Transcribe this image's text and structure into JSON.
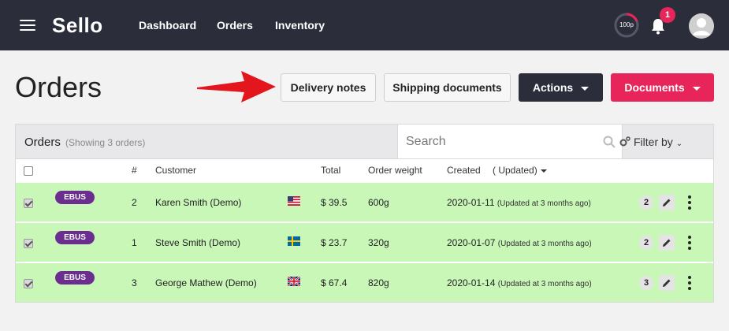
{
  "nav": {
    "logo": "Sello",
    "links": [
      "Dashboard",
      "Orders",
      "Inventory"
    ],
    "progress_label": "100p",
    "notification_count": "1"
  },
  "page": {
    "title": "Orders",
    "buttons": {
      "delivery_notes": "Delivery notes",
      "shipping_documents": "Shipping documents",
      "actions": "Actions",
      "documents": "Documents"
    }
  },
  "panel": {
    "title": "Orders",
    "subtitle": "(Showing 3 orders)",
    "search_placeholder": "Search",
    "filter_label": "Filter by"
  },
  "columns": {
    "number": "#",
    "customer": "Customer",
    "total": "Total",
    "weight": "Order weight",
    "created": "Created",
    "updated": "( Updated"
  },
  "rows": [
    {
      "tag": "EBUS",
      "number": "2",
      "customer": "Karen Smith (Demo)",
      "flag": "us-flag",
      "total": "$ 39.5",
      "weight": "600g",
      "created": "2020-01-11",
      "updated": "(Updated at 3 months ago)",
      "count": "2"
    },
    {
      "tag": "EBUS",
      "number": "1",
      "customer": "Steve Smith (Demo)",
      "flag": "se-flag",
      "total": "$ 23.7",
      "weight": "320g",
      "created": "2020-01-07",
      "updated": "(Updated at 3 months ago)",
      "count": "2"
    },
    {
      "tag": "EBUS",
      "number": "3",
      "customer": "George Mathew (Demo)",
      "flag": "uk-flag",
      "total": "$ 67.4",
      "weight": "820g",
      "created": "2020-01-14",
      "updated": "(Updated at 3 months ago)",
      "count": "3"
    }
  ],
  "colors": {
    "nav_bg": "#2b2e3a",
    "accent_pink": "#e8255a",
    "row_green": "#c8f7b8",
    "tag_purple": "#6b2d8f",
    "arrow_red": "#e3161d"
  }
}
